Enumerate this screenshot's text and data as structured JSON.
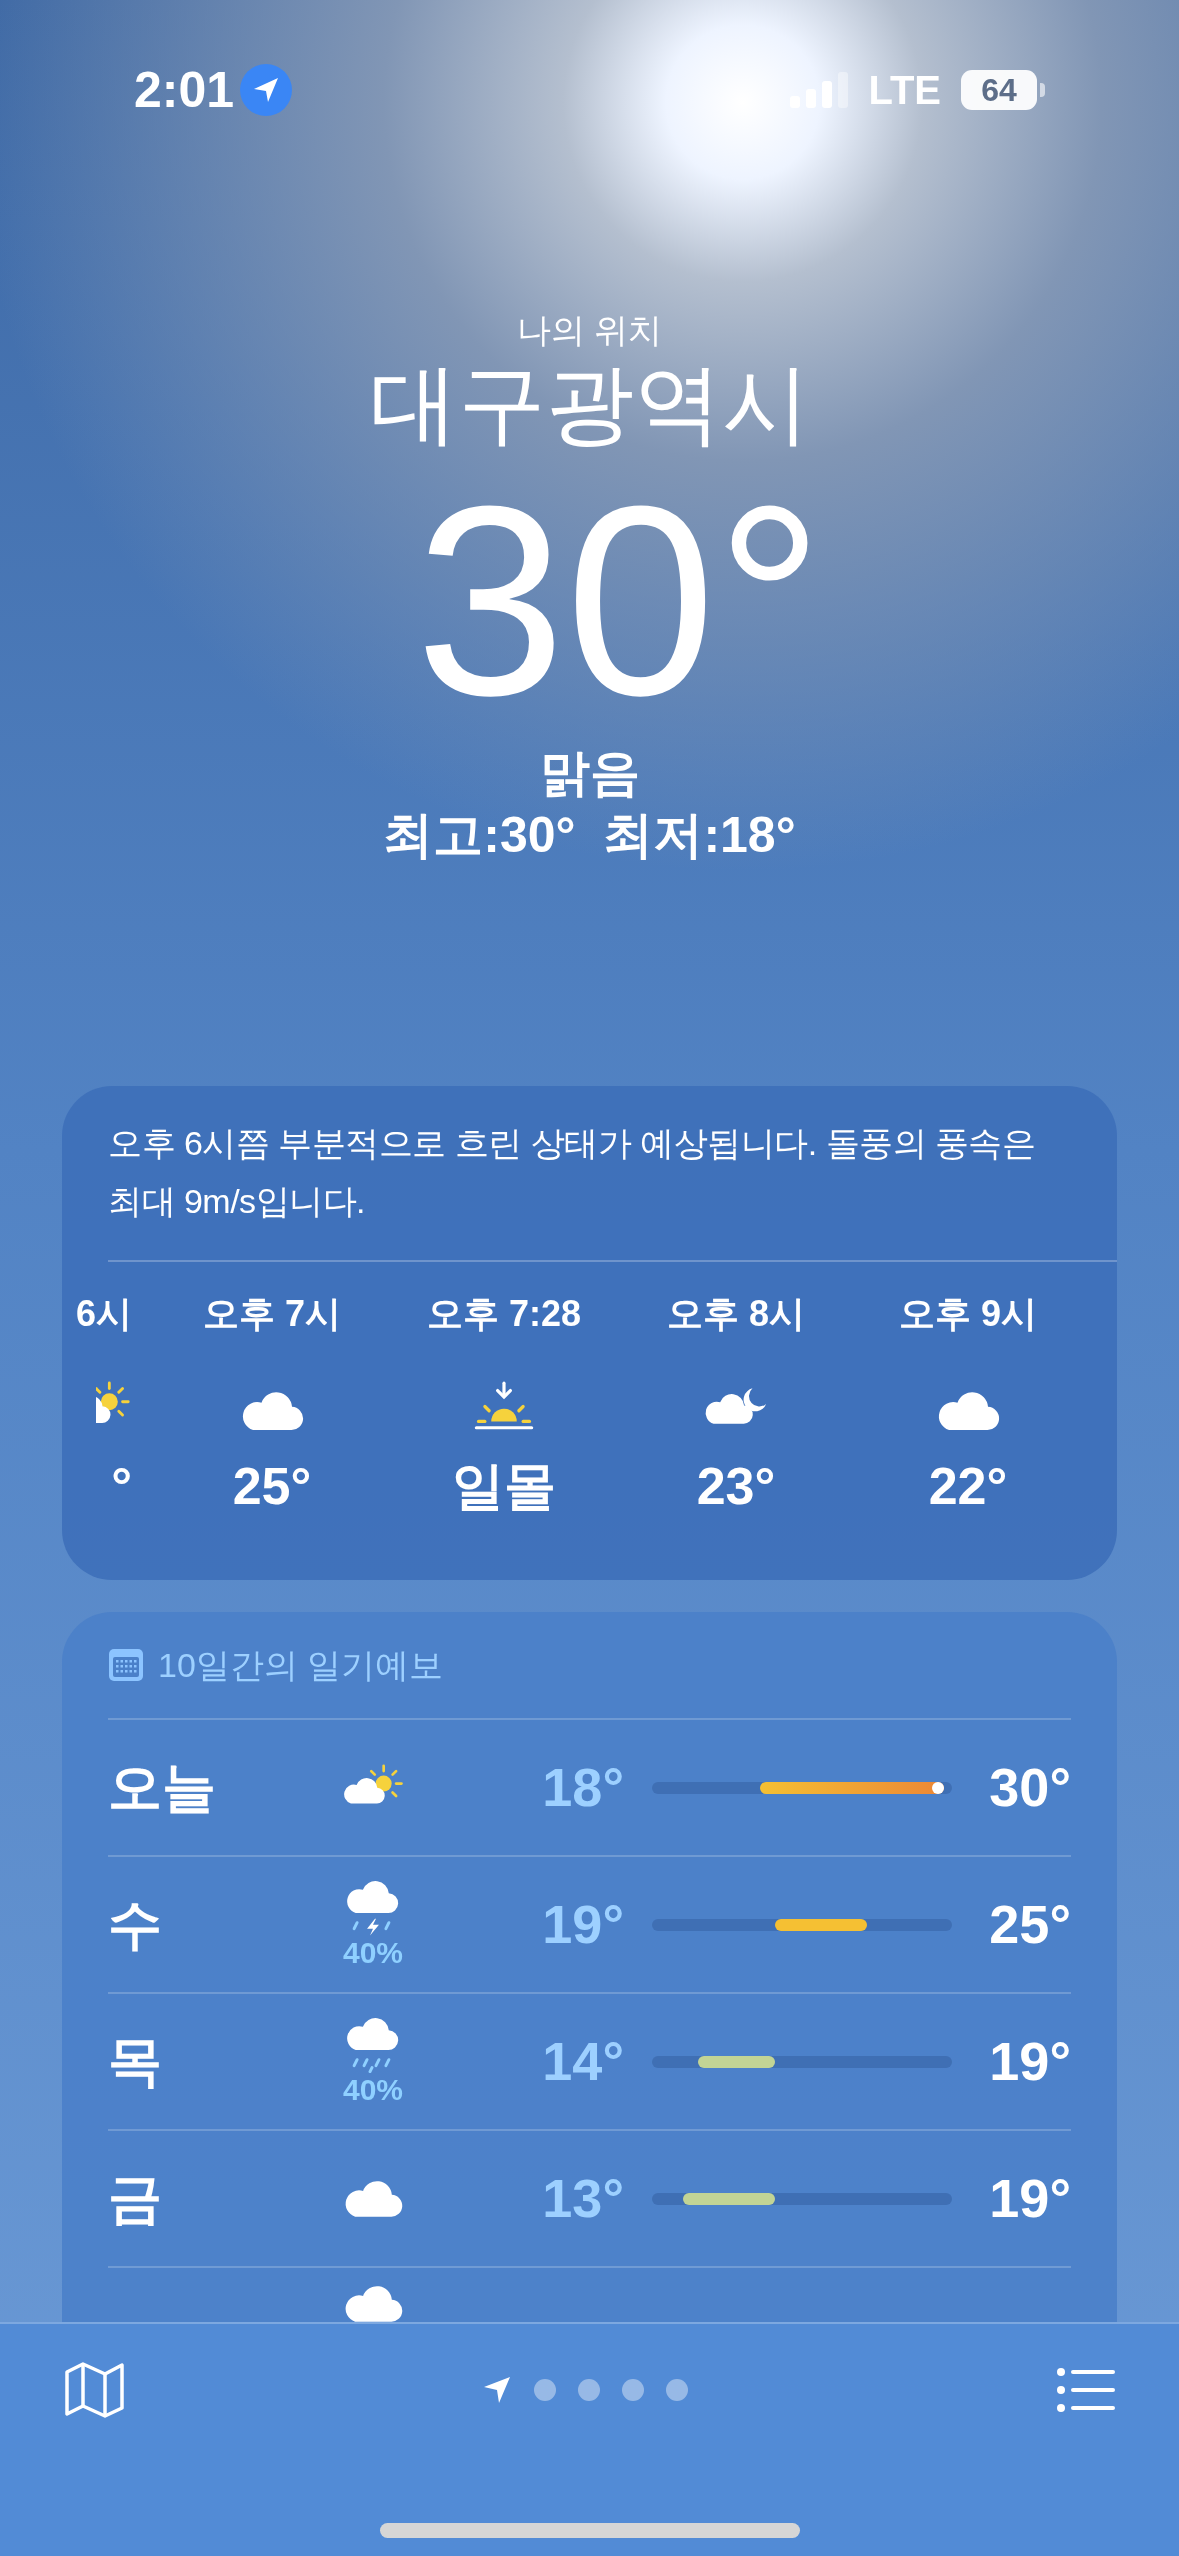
{
  "status_bar": {
    "time": "2:01",
    "network": "LTE",
    "battery": "64"
  },
  "header": {
    "location_label": "나의 위치",
    "city": "대구광역시",
    "temperature": "30°",
    "condition": "맑음",
    "high_low": "최고:30°  최저:18°"
  },
  "hourly": {
    "summary": "오후 6시쯤 부분적으로 흐린 상태가 예상됩니다. 돌풍의 풍속은 최대 9m/s입니다.",
    "items": [
      {
        "kind": "sun_cloud",
        "time": "6시",
        "temp": "°"
      },
      {
        "kind": "cloud",
        "time": "오후 7시",
        "temp": "25°"
      },
      {
        "kind": "sunset",
        "time": "오후 7:28",
        "temp": "일몰"
      },
      {
        "kind": "cloud_moon",
        "time": "오후 8시",
        "temp": "23°"
      },
      {
        "kind": "cloud",
        "time": "오후 9시",
        "temp": "22°"
      }
    ]
  },
  "forecast": {
    "title": "10일간의 일기예보",
    "days": [
      {
        "day": "오늘",
        "kind": "partly_sunny",
        "low": "18°",
        "high": "30°",
        "current": true
      },
      {
        "day": "수",
        "kind": "thunderstorm",
        "precip": "40%",
        "low": "19°",
        "high": "25°",
        "current": false
      },
      {
        "day": "목",
        "kind": "rain",
        "precip": "40%",
        "low": "14°",
        "high": "19°",
        "current": false
      },
      {
        "day": "금",
        "kind": "cloud",
        "low": "13°",
        "high": "19°",
        "current": false
      },
      {
        "kind": "cloud"
      }
    ]
  },
  "pages": [
    {
      "kind": "location",
      "selected": true
    },
    {
      "kind": "dot",
      "selected": false
    },
    {
      "kind": "dot",
      "selected": false
    },
    {
      "kind": "dot",
      "selected": false
    },
    {
      "kind": "dot",
      "selected": false
    }
  ]
}
